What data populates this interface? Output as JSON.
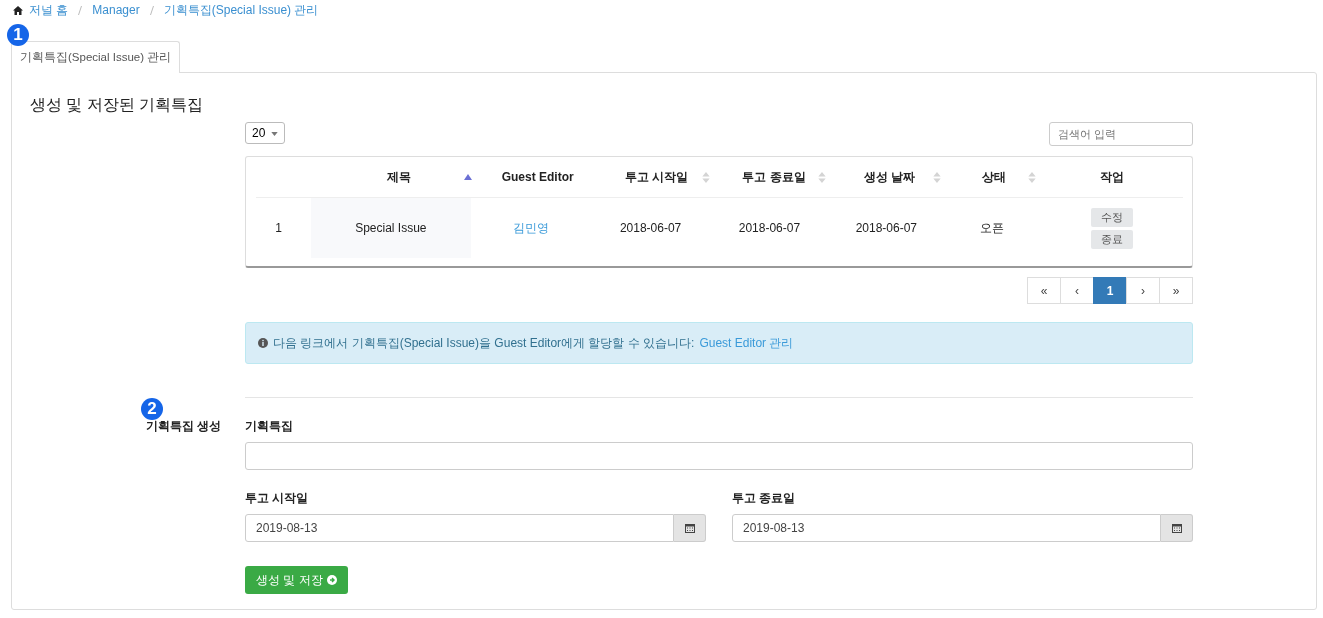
{
  "breadcrumb": [
    {
      "label": "저널 홈"
    },
    {
      "label": "Manager"
    },
    {
      "label": "기획특집(Special Issue) 관리"
    }
  ],
  "markers": [
    "1",
    "2"
  ],
  "tabs": [
    {
      "label": "기획특집(Special Issue) 관리",
      "selected": true
    }
  ],
  "section_title": "생성 및 저장된 기획특집",
  "page_size": "20",
  "search": {
    "placeholder": "검색어 입력"
  },
  "table": {
    "columns": [
      {
        "sortable": false
      },
      {
        "label": "제목",
        "sortable": true,
        "sorted": true
      },
      {
        "label": "Guest Editor",
        "sortable": false
      },
      {
        "label": "투고 시작일",
        "sortable": true,
        "sorted": false
      },
      {
        "label": "투고 종료일",
        "sortable": true,
        "sorted": false
      },
      {
        "label": "생성 날짜",
        "sortable": true,
        "sorted": false
      },
      {
        "label": "상태",
        "sortable": true,
        "sorted": false
      },
      {
        "label": "작업",
        "sortable": false
      }
    ],
    "rows": [
      {
        "cells": [
          "1",
          "Special Issue",
          "김민영",
          "2018-06-07",
          "2018-06-07",
          "2018-06-07",
          "오픈"
        ],
        "actions": [
          "수정",
          "종료"
        ]
      }
    ]
  },
  "pagination": [
    {
      "label": "«",
      "selected": false
    },
    {
      "label": "‹",
      "selected": false
    },
    {
      "label": "1",
      "selected": true
    },
    {
      "label": "›",
      "selected": false
    },
    {
      "label": "»",
      "selected": false
    }
  ],
  "info": {
    "text": "다음 링크에서 기획특집(Special Issue)을 Guest Editor에게 할당할 수 있습니다:",
    "link": "Guest Editor 관리"
  },
  "form": {
    "section_label": "기획특집 생성",
    "title_label": "기획특집",
    "start_label": "투고 시작일",
    "start_value": "2019-08-13",
    "end_label": "투고 종료일",
    "end_value": "2019-08-13",
    "submit": "생성 및 저장"
  }
}
